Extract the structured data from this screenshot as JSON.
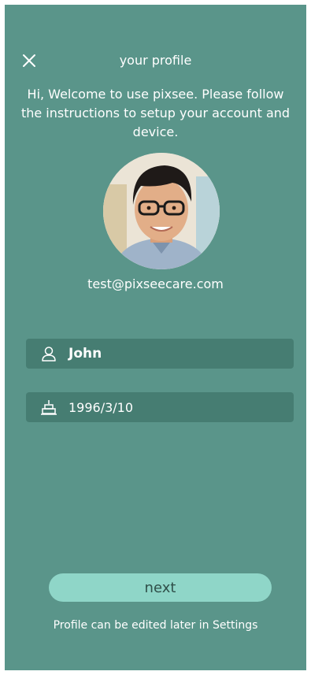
{
  "header": {
    "title": "your profile",
    "close_icon": "close-icon"
  },
  "welcome_text": "Hi, Welcome to use pixsee. Please follow the instructions to setup your account and device.",
  "profile": {
    "email": "test@pixseecare.com",
    "avatar": "user-avatar-photo"
  },
  "form": {
    "name": {
      "icon": "person-icon",
      "value": "John"
    },
    "birthday": {
      "icon": "birthday-cake-icon",
      "value": "1996/3/10"
    }
  },
  "next_button_label": "next",
  "footer_note": "Profile can be edited later in Settings",
  "colors": {
    "background": "#5a958a",
    "field_background": "#467d72",
    "button_background": "#8fd6c8",
    "button_text": "#2f4f49",
    "text": "#ffffff"
  }
}
